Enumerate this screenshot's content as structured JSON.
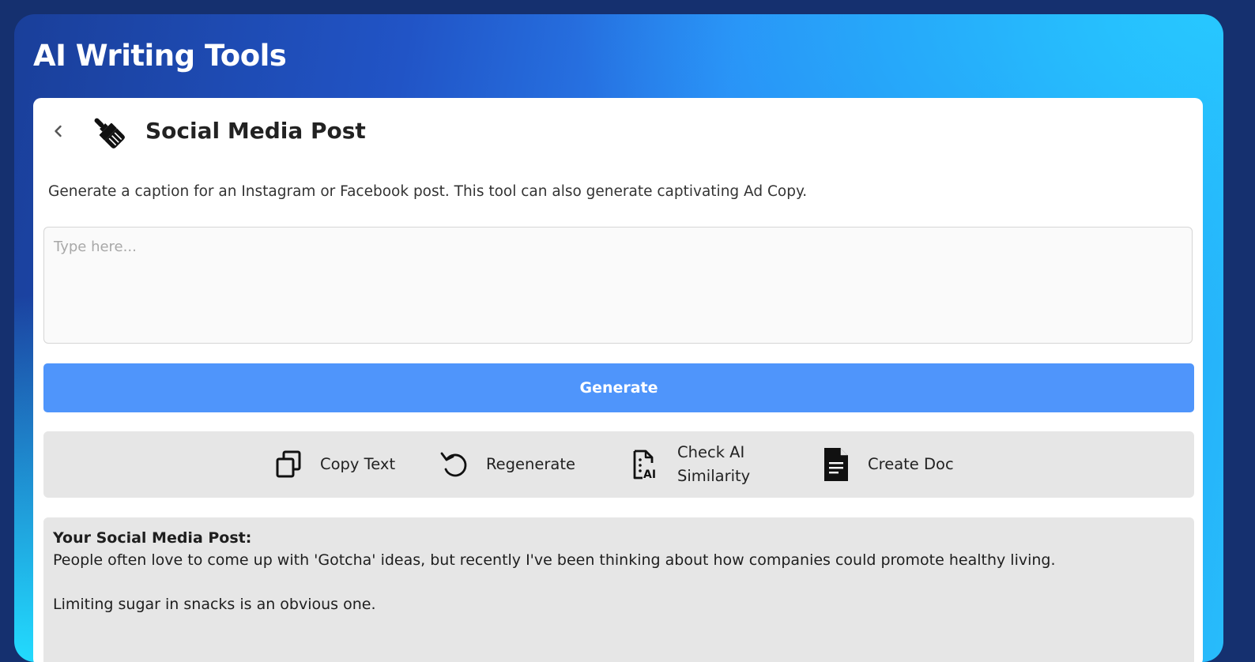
{
  "app": {
    "title": "AI Writing Tools"
  },
  "tool": {
    "title": "Social Media Post",
    "icon": "paint-brush-icon",
    "description": "Generate a caption for an Instagram or Facebook post. This tool can also generate captivating Ad Copy."
  },
  "prompt": {
    "placeholder": "Type here...",
    "value": ""
  },
  "generate": {
    "label": "Generate",
    "color": "#4f95fb"
  },
  "actions": [
    {
      "label": "Copy Text",
      "icon": "copy-icon"
    },
    {
      "label": "Regenerate",
      "icon": "regenerate-icon"
    },
    {
      "label": "Check AI Similarity",
      "icon": "ai-document-icon"
    },
    {
      "label": "Create Doc",
      "icon": "document-icon"
    }
  ],
  "output": {
    "heading": "Your Social Media Post:",
    "paragraphs": [
      "People often love to come up with 'Gotcha' ideas, but recently I've been thinking about how companies could promote healthy living.",
      "Limiting sugar in snacks is an obvious one."
    ]
  }
}
